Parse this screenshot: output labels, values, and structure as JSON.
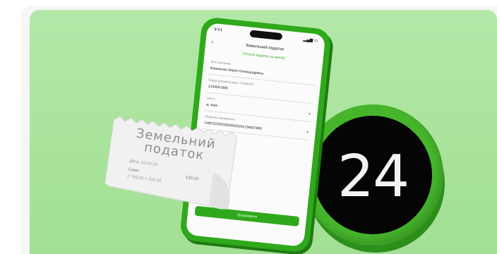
{
  "colors": {
    "background": "#a9e39b",
    "phone": "#2fa91b",
    "coin": "#46b52c",
    "coin_center": "#050505"
  },
  "coin": {
    "label": "24"
  },
  "phone": {
    "status_time": "9:41",
    "header_title": "Земельний податок",
    "subheader": "Оплата податку за землю",
    "fields": [
      {
        "label": "Ім'я платника",
        "value": "Коваленко Марія Олександрівна"
      },
      {
        "label": "Кадастровий номер / РНОКПП",
        "value": "1234567890"
      },
      {
        "label": "Місто",
        "value": "м. Київ"
      },
      {
        "label": "Рахунок отримувача",
        "value": "UA873220010000026201234567890"
      }
    ],
    "pay_button": "Продовжити"
  },
  "receipt": {
    "title_line1": "Земельний",
    "title_line2": "податок",
    "date_label": "Дата: 10.06.24",
    "sum_label": "Сума",
    "sum_value": "130,00",
    "note": "2 765,00 + 120,00"
  }
}
